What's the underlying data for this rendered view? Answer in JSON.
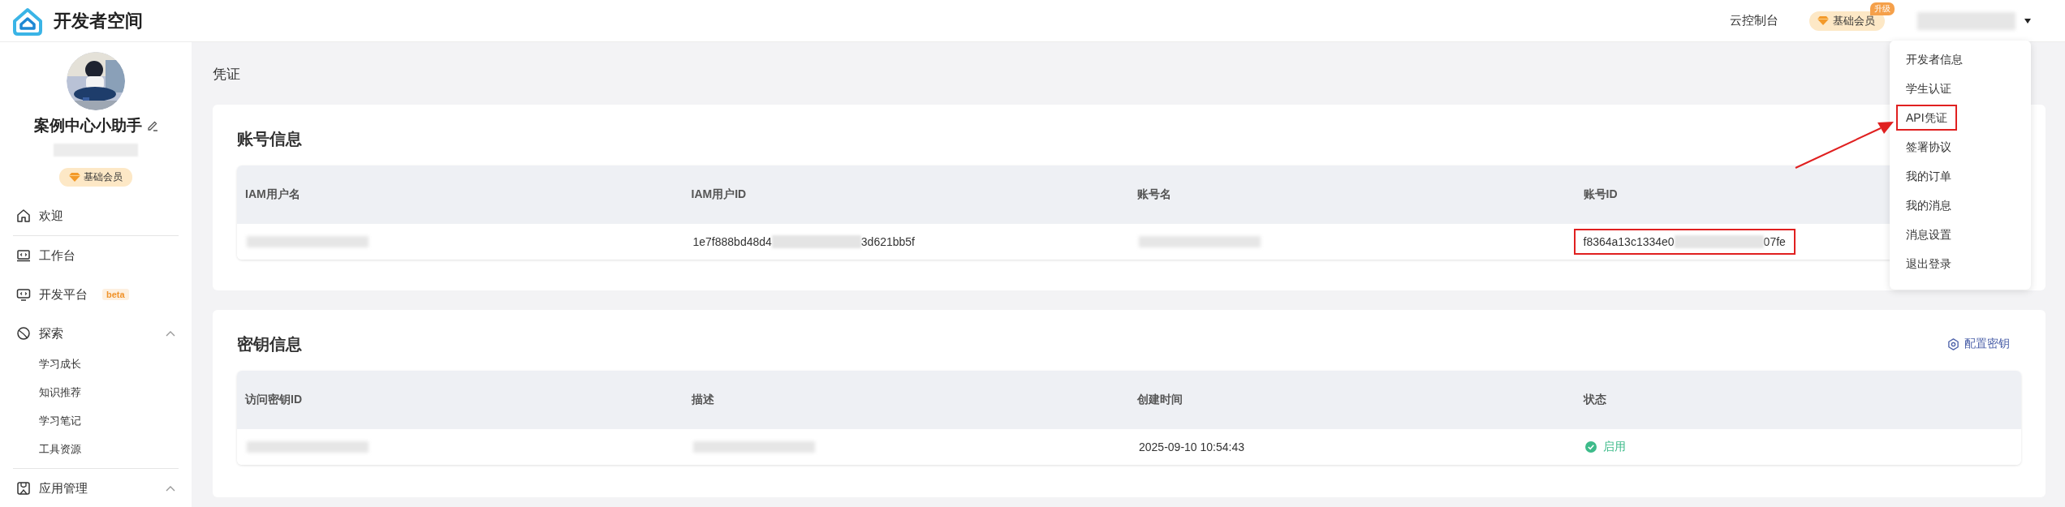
{
  "header": {
    "title": "开发者空间",
    "console_link": "云控制台",
    "membership": {
      "label": "基础会员",
      "tag": "升级"
    },
    "user_menu": {
      "expanded": true,
      "items": [
        {
          "label": "开发者信息",
          "highlighted": false
        },
        {
          "label": "学生认证",
          "highlighted": false
        },
        {
          "label": "API凭证",
          "highlighted": true
        },
        {
          "label": "签署协议",
          "highlighted": false
        },
        {
          "label": "我的订单",
          "highlighted": false
        },
        {
          "label": "我的消息",
          "highlighted": false
        },
        {
          "label": "消息设置",
          "highlighted": false
        },
        {
          "label": "退出登录",
          "highlighted": false
        }
      ]
    }
  },
  "sidebar": {
    "profile": {
      "name": "案例中心小助手",
      "badge": "基础会员"
    },
    "items": [
      {
        "label": "欢迎",
        "divider_after": true
      },
      {
        "label": "工作台",
        "divider_after": false
      },
      {
        "label": "开发平台",
        "badge": "beta",
        "divider_after": false
      },
      {
        "label": "探索",
        "expanded": true,
        "divider_after": true,
        "children": [
          {
            "label": "学习成长"
          },
          {
            "label": "知识推荐"
          },
          {
            "label": "学习笔记"
          },
          {
            "label": "工具资源"
          }
        ]
      },
      {
        "label": "应用管理",
        "expanded": true,
        "divider_after": false
      }
    ]
  },
  "main": {
    "page_title": "凭证",
    "cards": [
      {
        "title": "账号信息",
        "columns": [
          "IAM用户名",
          "IAM用户ID",
          "账号名",
          "账号ID"
        ],
        "rows": [
          [
            {
              "kind": "redacted",
              "highlighted": false
            },
            {
              "kind": "masked",
              "start": "1e7f888bd48d4",
              "end": "3d621bb5f",
              "highlighted": false
            },
            {
              "kind": "redacted",
              "highlighted": false
            },
            {
              "kind": "masked",
              "start": "f8364a13c1334e0",
              "end": "07fe",
              "highlighted": true
            }
          ]
        ]
      },
      {
        "title": "密钥信息",
        "action": "配置密钥",
        "columns": [
          "访问密钥ID",
          "描述",
          "创建时间",
          "状态"
        ],
        "rows": [
          [
            {
              "kind": "redacted",
              "highlighted": false
            },
            {
              "kind": "redacted",
              "highlighted": false
            },
            {
              "kind": "text",
              "text": "2025-09-10 10:54:43",
              "highlighted": false
            },
            {
              "kind": "status",
              "text": "启用",
              "on": true,
              "highlighted": false
            }
          ]
        ]
      }
    ]
  },
  "annotation_arrow": true
}
